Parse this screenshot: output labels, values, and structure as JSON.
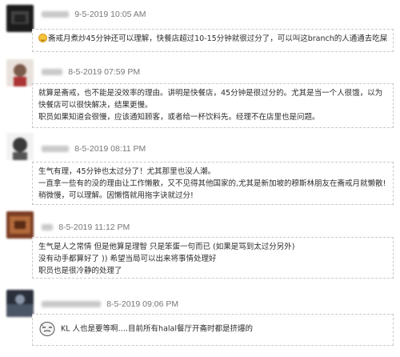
{
  "comments": [
    {
      "timestamp": "9-5-2019 10:05 AM",
      "lines": [
        "斋戒月煮炒45分钟还可以理解，快餐店超过10-15分钟就很过分了，可以叫这branch的人通通去吃屎"
      ],
      "emoji": "smile-emoji"
    },
    {
      "timestamp": "8-5-2019 07:59 PM",
      "lines": [
        "就算是斋戒，也不能是没效率的理由。讲明是快餐店，45分钟是很过分的。尤其是当一个人很饿，以为",
        "快餐店可以很快解决，结果更慢。",
        "职员如果知道会很慢，应该通知顾客，或者给一杯饮料先。经理不在店里也是问题。"
      ]
    },
    {
      "timestamp": "8-5-2019 08:11 PM",
      "lines": [
        "生气有理，45分钟也太过分了！尤其那里也没人潮。",
        "一直拿一些有的没的理由让工作懒散，又不见得其他国家的,尤其是新加坡的穆斯林朋友在斋戒月就懒散!",
        "稍微慢，可以理解。因懒惰就用拖字诀就过分!"
      ]
    },
    {
      "timestamp": "8-5-2019 11:12 PM",
      "lines": [
        "生气是人之常情 但是他算是理智 只是笨蛋一句而已 (如果是骂到太过分另外)",
        "没有动手都算好了 )) 希望当局可以出来将事情处理好",
        "职员也是很冷静的处理了"
      ]
    },
    {
      "timestamp": "8-5-2019 09:06 PM",
      "lines": [
        "KL 人也是要等啊….目前所有halal餐厅开斋时都是挤爆的"
      ],
      "emoji": "sticker-face"
    }
  ]
}
